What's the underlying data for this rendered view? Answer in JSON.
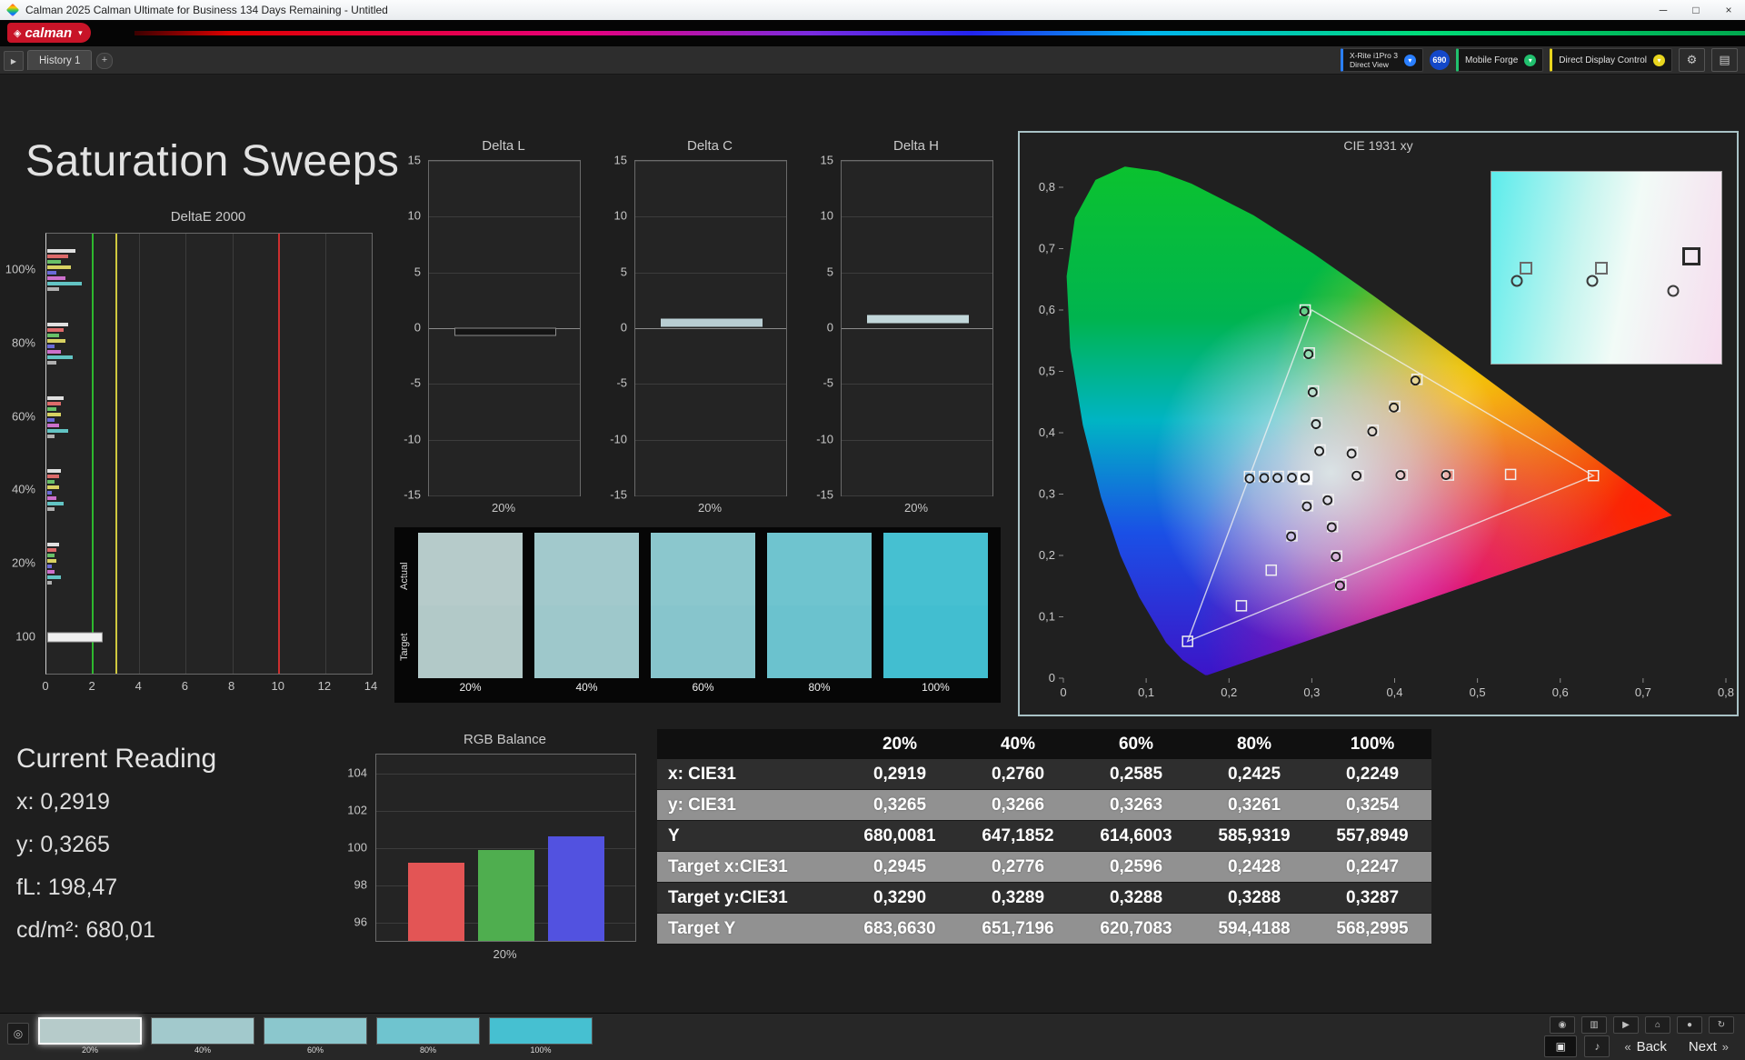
{
  "titlebar": {
    "title": "Calman 2025 Calman Ultimate for Business 134 Days Remaining - Untitled",
    "minimize": "─",
    "maximize": "□",
    "close": "×"
  },
  "brand": {
    "logo": "calman"
  },
  "icons": {
    "logo_diamond": "◈",
    "panel_toggle": "▶",
    "add": "+",
    "dropdown": "▾",
    "gear": "⚙",
    "menu": "▤",
    "eye": "◎",
    "pattern": "▣",
    "audio": "♪",
    "back_arrow": "«",
    "next_arrow": "»",
    "tools": [
      {
        "name": "eye",
        "glyph": "◉"
      },
      {
        "name": "trash",
        "glyph": "▥"
      },
      {
        "name": "play",
        "glyph": "▶"
      },
      {
        "name": "home",
        "glyph": "⌂"
      },
      {
        "name": "record",
        "glyph": "●"
      },
      {
        "name": "refresh",
        "glyph": "↻"
      }
    ]
  },
  "tabbar": {
    "history_tab": "History 1",
    "meter": {
      "line1": "X-Rite i1Pro 3",
      "line2": "Direct View",
      "accent": "#2a7fff"
    },
    "badge": {
      "text": "690",
      "color": "#1448c8"
    },
    "source": {
      "label": "Mobile Forge",
      "accent": "#21c06e"
    },
    "display": {
      "label": "Direct Display Control",
      "accent": "#e8d51e"
    }
  },
  "page_title": "Saturation Sweeps",
  "deltae": {
    "title": "DeltaE 2000",
    "xlim": [
      0,
      14
    ],
    "x_ticks": [
      0,
      2,
      4,
      6,
      8,
      10,
      12,
      14
    ],
    "ref_lines": [
      {
        "value": 2,
        "color": "#2db82d"
      },
      {
        "value": 3,
        "color": "#cfc93f"
      },
      {
        "value": 10,
        "color": "#cc2f2f"
      }
    ],
    "groups": [
      {
        "label": "100%",
        "bars": [
          {
            "value": 1.2,
            "color": "#e0e0e0"
          },
          {
            "value": 0.9,
            "color": "#dd6a6a"
          },
          {
            "value": 0.6,
            "color": "#68c068"
          },
          {
            "value": 1.0,
            "color": "#d8d262"
          },
          {
            "value": 0.4,
            "color": "#6a6ad8"
          },
          {
            "value": 0.8,
            "color": "#cc70cc"
          },
          {
            "value": 1.5,
            "color": "#62c4c4"
          },
          {
            "value": 0.5,
            "color": "#b0b0b0"
          }
        ]
      },
      {
        "label": "80%",
        "bars": [
          {
            "value": 0.9,
            "color": "#e0e0e0"
          },
          {
            "value": 0.7,
            "color": "#dd6a6a"
          },
          {
            "value": 0.5,
            "color": "#68c068"
          },
          {
            "value": 0.8,
            "color": "#d8d262"
          },
          {
            "value": 0.3,
            "color": "#6a6ad8"
          },
          {
            "value": 0.6,
            "color": "#cc70cc"
          },
          {
            "value": 1.1,
            "color": "#62c4c4"
          },
          {
            "value": 0.4,
            "color": "#b0b0b0"
          }
        ]
      },
      {
        "label": "60%",
        "bars": [
          {
            "value": 0.7,
            "color": "#e0e0e0"
          },
          {
            "value": 0.6,
            "color": "#dd6a6a"
          },
          {
            "value": 0.4,
            "color": "#68c068"
          },
          {
            "value": 0.6,
            "color": "#d8d262"
          },
          {
            "value": 0.3,
            "color": "#6a6ad8"
          },
          {
            "value": 0.5,
            "color": "#cc70cc"
          },
          {
            "value": 0.9,
            "color": "#62c4c4"
          },
          {
            "value": 0.3,
            "color": "#b0b0b0"
          }
        ]
      },
      {
        "label": "40%",
        "bars": [
          {
            "value": 0.6,
            "color": "#e0e0e0"
          },
          {
            "value": 0.5,
            "color": "#dd6a6a"
          },
          {
            "value": 0.3,
            "color": "#68c068"
          },
          {
            "value": 0.5,
            "color": "#d8d262"
          },
          {
            "value": 0.2,
            "color": "#6a6ad8"
          },
          {
            "value": 0.4,
            "color": "#cc70cc"
          },
          {
            "value": 0.7,
            "color": "#62c4c4"
          },
          {
            "value": 0.3,
            "color": "#b0b0b0"
          }
        ]
      },
      {
        "label": "20%",
        "bars": [
          {
            "value": 0.5,
            "color": "#e0e0e0"
          },
          {
            "value": 0.4,
            "color": "#dd6a6a"
          },
          {
            "value": 0.3,
            "color": "#68c068"
          },
          {
            "value": 0.4,
            "color": "#d8d262"
          },
          {
            "value": 0.2,
            "color": "#6a6ad8"
          },
          {
            "value": 0.3,
            "color": "#cc70cc"
          },
          {
            "value": 0.6,
            "color": "#62c4c4"
          },
          {
            "value": 0.2,
            "color": "#b0b0b0"
          }
        ]
      },
      {
        "label": "100",
        "bars": [
          {
            "value": 2.3,
            "color": "#f0f0f0",
            "thick": true
          }
        ]
      }
    ]
  },
  "delta_small": [
    {
      "title": "Delta L",
      "ylim": [
        -15,
        15
      ],
      "y_ticks": [
        15,
        10,
        5,
        0,
        -5,
        -10,
        -15
      ],
      "x_label": "20%",
      "value": -0.3,
      "color": "#141414",
      "border": "#8a8a8a"
    },
    {
      "title": "Delta C",
      "ylim": [
        -15,
        15
      ],
      "y_ticks": [
        15,
        10,
        5,
        0,
        -5,
        -10,
        -15
      ],
      "x_label": "20%",
      "value": 0.5,
      "color": "#b9ced3",
      "border": "#b9ced3"
    },
    {
      "title": "Delta H",
      "ylim": [
        -15,
        15
      ],
      "y_ticks": [
        15,
        10,
        5,
        0,
        -5,
        -10,
        -15
      ],
      "x_label": "20%",
      "value": 0.8,
      "color": "#c2d7da",
      "border": "#c2d7da"
    }
  ],
  "swatches": {
    "row_labels": [
      "Actual",
      "Target"
    ],
    "items": [
      {
        "label": "20%",
        "actual": "#b6cbca",
        "target": "#b2c9c8"
      },
      {
        "label": "40%",
        "actual": "#a2c9cc",
        "target": "#9ec8cb"
      },
      {
        "label": "60%",
        "actual": "#8bc7cd",
        "target": "#87c5cc"
      },
      {
        "label": "80%",
        "actual": "#6fc4cf",
        "target": "#6bc2ce"
      },
      {
        "label": "100%",
        "actual": "#46c0d1",
        "target": "#42bed0"
      }
    ]
  },
  "cie": {
    "title": "CIE 1931 xy",
    "xlim": [
      0,
      0.8
    ],
    "ylim": [
      0,
      0.8
    ],
    "x_ticks": [
      "0",
      "0,1",
      "0,2",
      "0,3",
      "0,4",
      "0,5",
      "0,6",
      "0,7",
      "0,8"
    ],
    "y_ticks": [
      "0",
      "0,1",
      "0,2",
      "0,3",
      "0,4",
      "0,5",
      "0,6",
      "0,7",
      "0,8"
    ],
    "gamut_triangle": [
      [
        0.64,
        0.33
      ],
      [
        0.3,
        0.6
      ],
      [
        0.15,
        0.06
      ]
    ],
    "white_point": [
      0.3127,
      0.329
    ],
    "current": [
      0.2919,
      0.3265
    ],
    "sweeps": [
      {
        "name": "green",
        "targets": [
          [
            0.31,
            0.372
          ],
          [
            0.306,
            0.416
          ],
          [
            0.302,
            0.468
          ],
          [
            0.297,
            0.53
          ],
          [
            0.292,
            0.6
          ]
        ],
        "measured": [
          [
            0.309,
            0.37
          ],
          [
            0.305,
            0.414
          ],
          [
            0.301,
            0.466
          ],
          [
            0.296,
            0.528
          ],
          [
            0.291,
            0.598
          ]
        ]
      },
      {
        "name": "yellow",
        "targets": [
          [
            0.349,
            0.368
          ],
          [
            0.374,
            0.404
          ],
          [
            0.4,
            0.443
          ],
          [
            0.427,
            0.487
          ]
        ],
        "measured": [
          [
            0.348,
            0.366
          ],
          [
            0.373,
            0.402
          ],
          [
            0.399,
            0.441
          ],
          [
            0.425,
            0.485
          ]
        ]
      },
      {
        "name": "red",
        "targets": [
          [
            0.356,
            0.33
          ],
          [
            0.409,
            0.331
          ],
          [
            0.465,
            0.331
          ],
          [
            0.54,
            0.332
          ],
          [
            0.64,
            0.33
          ]
        ],
        "measured": [
          [
            0.354,
            0.33
          ],
          [
            0.407,
            0.331
          ],
          [
            0.462,
            0.331
          ]
        ]
      },
      {
        "name": "magenta",
        "targets": [
          [
            0.32,
            0.291
          ],
          [
            0.325,
            0.247
          ],
          [
            0.33,
            0.199
          ],
          [
            0.335,
            0.152
          ]
        ],
        "measured": [
          [
            0.319,
            0.29
          ],
          [
            0.324,
            0.246
          ],
          [
            0.329,
            0.198
          ],
          [
            0.334,
            0.151
          ]
        ]
      },
      {
        "name": "blue",
        "targets": [
          [
            0.295,
            0.281
          ],
          [
            0.276,
            0.232
          ],
          [
            0.251,
            0.176
          ],
          [
            0.215,
            0.118
          ],
          [
            0.15,
            0.06
          ]
        ],
        "measured": [
          [
            0.294,
            0.28
          ],
          [
            0.275,
            0.231
          ]
        ]
      },
      {
        "name": "cyan",
        "targets": [
          [
            0.2945,
            0.329
          ],
          [
            0.2776,
            0.3289
          ],
          [
            0.2596,
            0.3288
          ],
          [
            0.2428,
            0.3288
          ],
          [
            0.2247,
            0.3287
          ]
        ],
        "measured": [
          [
            0.2919,
            0.3265
          ],
          [
            0.276,
            0.3266
          ],
          [
            0.2585,
            0.3263
          ],
          [
            0.2425,
            0.3261
          ],
          [
            0.2249,
            0.3254
          ]
        ]
      }
    ],
    "inset_markers": [
      {
        "type": "circle",
        "x": 11,
        "y": 57
      },
      {
        "type": "square",
        "x": 15,
        "y": 50
      },
      {
        "type": "circle",
        "x": 44,
        "y": 57
      },
      {
        "type": "square",
        "x": 48,
        "y": 50
      },
      {
        "type": "circle",
        "x": 79,
        "y": 62
      },
      {
        "type": "square_bold",
        "x": 87,
        "y": 44
      }
    ]
  },
  "current_reading": {
    "title": "Current Reading",
    "lines": [
      "x: 0,2919",
      "y: 0,3265",
      "fL: 198,47",
      "cd/m²: 680,01"
    ]
  },
  "rgb_balance": {
    "title": "RGB Balance",
    "ylim": [
      95,
      105
    ],
    "y_ticks": [
      104,
      102,
      100,
      98,
      96
    ],
    "x_label": "20%",
    "bars": [
      {
        "name": "red",
        "value": 99.2,
        "color": "#e35555"
      },
      {
        "name": "green",
        "value": 99.9,
        "color": "#4fae4f"
      },
      {
        "name": "blue",
        "value": 100.6,
        "color": "#5252e0"
      }
    ]
  },
  "table": {
    "columns": [
      "",
      "20%",
      "40%",
      "60%",
      "80%",
      "100%"
    ],
    "rows": [
      {
        "label": "x: CIE31",
        "values": [
          "0,2919",
          "0,2760",
          "0,2585",
          "0,2425",
          "0,2249"
        ]
      },
      {
        "label": "y: CIE31",
        "values": [
          "0,3265",
          "0,3266",
          "0,3263",
          "0,3261",
          "0,3254"
        ]
      },
      {
        "label": "Y",
        "values": [
          "680,0081",
          "647,1852",
          "614,6003",
          "585,9319",
          "557,8949"
        ]
      },
      {
        "label": "Target x:CIE31",
        "values": [
          "0,2945",
          "0,2776",
          "0,2596",
          "0,2428",
          "0,2247"
        ]
      },
      {
        "label": "Target y:CIE31",
        "values": [
          "0,3290",
          "0,3289",
          "0,3288",
          "0,3288",
          "0,3287"
        ]
      },
      {
        "label": "Target Y",
        "values": [
          "683,6630",
          "651,7196",
          "620,7083",
          "594,4188",
          "568,2995"
        ]
      }
    ]
  },
  "bottom_bar": {
    "back": "Back",
    "next": "Next",
    "patches": [
      {
        "label": "20%",
        "color": "#b6cbca",
        "selected": true
      },
      {
        "label": "40%",
        "color": "#a2c9cc"
      },
      {
        "label": "60%",
        "color": "#8bc7cd"
      },
      {
        "label": "80%",
        "color": "#6fc4cf"
      },
      {
        "label": "100%",
        "color": "#46c0d1"
      }
    ]
  }
}
